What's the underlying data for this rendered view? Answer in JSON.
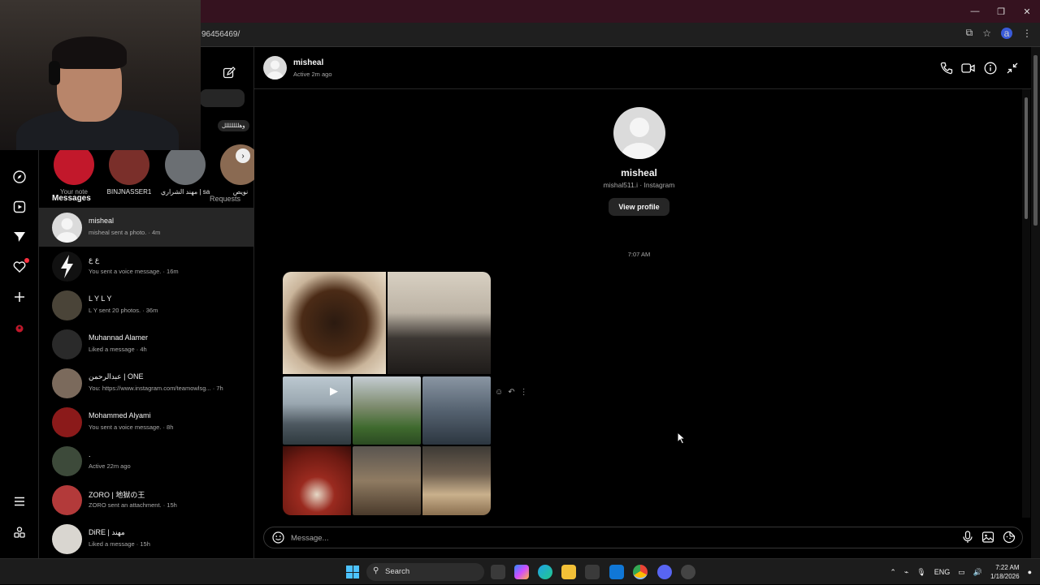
{
  "browser": {
    "url_fragment": "96456469/"
  },
  "inbox": {
    "notes": [
      {
        "name": "Your note",
        "bubble": ""
      },
      {
        "name": "BINJNASSER1",
        "bubble": ""
      },
      {
        "name": "مهند الشراري | sa",
        "bubble": ""
      },
      {
        "name": "نويص",
        "bubble": "وهلللللللل"
      }
    ],
    "messages_label": "Messages",
    "requests_label": "Requests",
    "conversations": [
      {
        "name": "misheal",
        "preview": "misheal sent a photo. · 4m"
      },
      {
        "name": "ع ع",
        "preview": "You sent a voice message. · 16m"
      },
      {
        "name": "L Y L Y",
        "preview": "L Y sent 20 photos. · 36m"
      },
      {
        "name": "Muhannad Alamer",
        "preview": "Liked a message · 4h"
      },
      {
        "name": "عبدالرحمن | ONE",
        "preview": "You: https://www.instagram.com/teamowlsg... · 7h"
      },
      {
        "name": "Mohammed Alyami",
        "preview": "You sent a voice message. · 8h"
      },
      {
        "name": ".",
        "preview": "Active 22m ago"
      },
      {
        "name": "ZORO | 地獄の王",
        "preview": "ZORO sent an attachment. · 15h"
      },
      {
        "name": "DiRE | مهند",
        "preview": "Liked a message · 15h"
      }
    ]
  },
  "chat": {
    "name": "misheal",
    "status": "Active 2m ago",
    "profile_name": "misheal",
    "profile_sub": "mishal511.i · Instagram",
    "view_profile": "View profile",
    "timestamp": "7:07 AM",
    "composer_placeholder": "Message..."
  },
  "taskbar": {
    "search_label": "Search",
    "lang": "ENG",
    "time": "7:22 AM",
    "date": "1/18/2026"
  },
  "colors": {
    "bg": "#000000",
    "panel_active": "#262626",
    "muted_text": "#a8a8a8",
    "notification_dot": "#ff3040",
    "browser_top": "#35121f"
  },
  "icons": [
    "compass-icon",
    "reels-icon",
    "send-icon",
    "heart-icon",
    "plus-icon",
    "menu-icon",
    "threads-icon",
    "phone-icon",
    "video-icon",
    "info-icon",
    "collapse-icon",
    "emoji-icon",
    "mic-icon",
    "image-icon",
    "sticker-icon",
    "search-icon"
  ]
}
